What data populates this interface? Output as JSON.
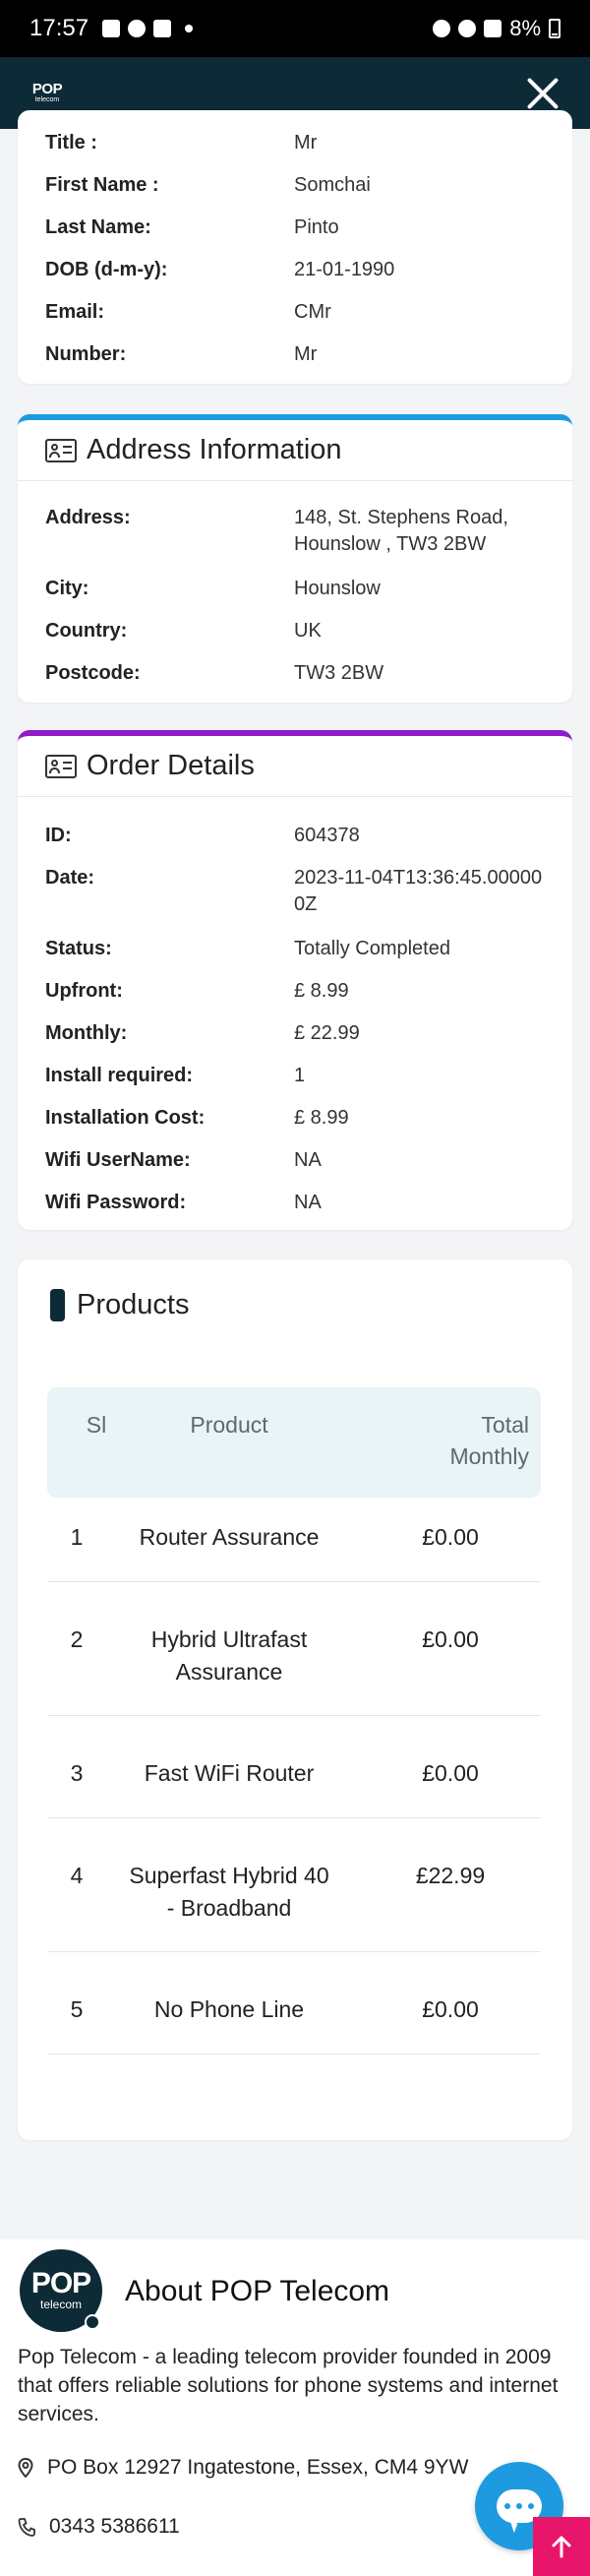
{
  "status_bar": {
    "time": "17:57",
    "battery": "8%"
  },
  "header": {
    "logo_text": "POP",
    "logo_sub": "telecom"
  },
  "personal": {
    "rows": [
      {
        "label": "Title :",
        "value": "Mr"
      },
      {
        "label": "First Name :",
        "value": "Somchai"
      },
      {
        "label": "Last Name:",
        "value": "Pinto"
      },
      {
        "label": "DOB (d-m-y):",
        "value": "21-01-1990"
      },
      {
        "label": "Email:",
        "value": "CMr"
      },
      {
        "label": "Number:",
        "value": "Mr"
      }
    ]
  },
  "address": {
    "title": "Address Information",
    "rows": [
      {
        "label": "Address:",
        "value": "148, St. Stephens Road, Hounslow , TW3 2BW"
      },
      {
        "label": "City:",
        "value": "Hounslow"
      },
      {
        "label": "Country:",
        "value": "UK"
      },
      {
        "label": "Postcode:",
        "value": "TW3 2BW"
      }
    ]
  },
  "order": {
    "title": "Order Details",
    "rows": [
      {
        "label": "ID:",
        "value": "604378"
      },
      {
        "label": "Date:",
        "value": "2023-11-04T13:36:45.000000Z"
      },
      {
        "label": "Status:",
        "value": "Totally Completed"
      },
      {
        "label": "Upfront:",
        "value": "£ 8.99"
      },
      {
        "label": "Monthly:",
        "value": "£ 22.99"
      },
      {
        "label": "Install required:",
        "value": "1"
      },
      {
        "label": "Installation Cost:",
        "value": "£ 8.99"
      },
      {
        "label": "Wifi UserName:",
        "value": "NA"
      },
      {
        "label": "Wifi Password:",
        "value": "NA"
      }
    ]
  },
  "products": {
    "title": "Products",
    "columns": [
      "Sl",
      "Product",
      "Total Monthly"
    ],
    "rows": [
      {
        "sl": "1",
        "product": "Router Assurance",
        "total": "£0.00"
      },
      {
        "sl": "2",
        "product": "Hybrid Ultrafast Assurance",
        "total": "£0.00"
      },
      {
        "sl": "3",
        "product": "Fast WiFi Router",
        "total": "£0.00"
      },
      {
        "sl": "4",
        "product": "Superfast Hybrid 40 - Broadband",
        "total": "£22.99"
      },
      {
        "sl": "5",
        "product": "No Phone Line",
        "total": "£0.00"
      }
    ]
  },
  "about": {
    "title": "About POP Telecom",
    "description": "Pop Telecom - a leading telecom provider founded in 2009 that offers reliable solutions for phone systems and internet services.",
    "address": "PO Box 12927 Ingatestone, Essex, CM4 9YW",
    "phone": "0343 5386611",
    "logo_text": "POP",
    "logo_sub": "telecom"
  },
  "colors": {
    "header_bg": "#0d2a37",
    "address_accent": "#1e9be0",
    "order_accent": "#8e1bc7",
    "table_header_bg": "#e8f4f6",
    "chat_button": "#1e9be0",
    "scroll_top_button": "#e8166a"
  }
}
